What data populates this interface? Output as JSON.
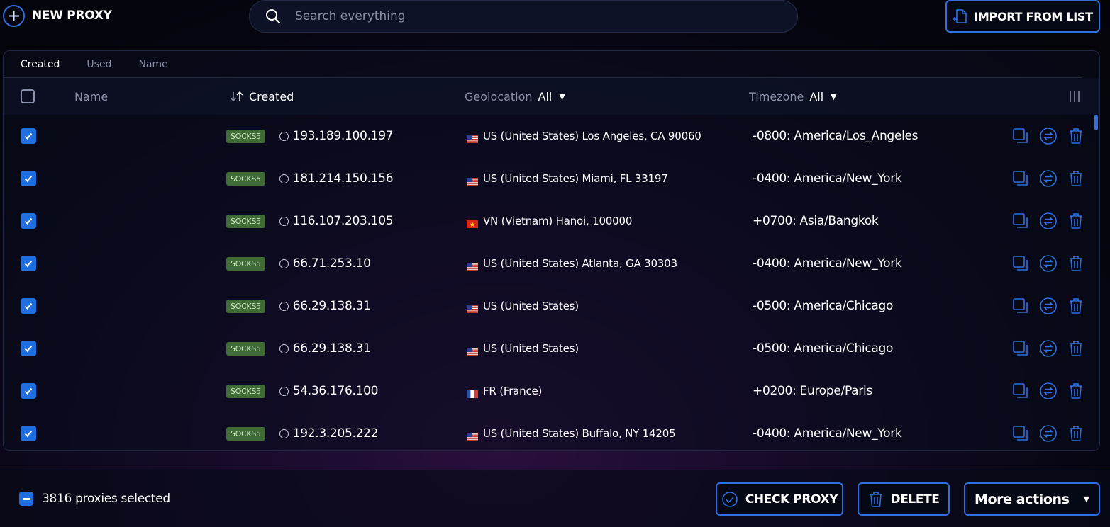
{
  "header": {
    "new_proxy_label": "NEW PROXY",
    "search_placeholder": "Search everything",
    "import_label": "IMPORT FROM LIST"
  },
  "sort_tabs": [
    {
      "label": "Created",
      "active": true
    },
    {
      "label": "Used",
      "active": false
    },
    {
      "label": "Name",
      "active": false
    }
  ],
  "columns": {
    "name": "Name",
    "created": "Created",
    "geolocation": "Geolocation",
    "geolocation_filter": "All",
    "timezone": "Timezone",
    "timezone_filter": "All"
  },
  "rows": [
    {
      "checked": true,
      "type": "SOCKS5",
      "ip": "193.189.100.197",
      "flag": "us",
      "geo": "US (United States) Los Angeles, CA 90060",
      "tz": "-0800: America/Los_Angeles"
    },
    {
      "checked": true,
      "type": "SOCKS5",
      "ip": "181.214.150.156",
      "flag": "us",
      "geo": "US (United States) Miami, FL 33197",
      "tz": "-0400: America/New_York"
    },
    {
      "checked": true,
      "type": "SOCKS5",
      "ip": "116.107.203.105",
      "flag": "vn",
      "geo": "VN (Vietnam) Hanoi, 100000",
      "tz": "+0700: Asia/Bangkok"
    },
    {
      "checked": true,
      "type": "SOCKS5",
      "ip": "66.71.253.10",
      "flag": "us",
      "geo": "US (United States) Atlanta, GA 30303",
      "tz": "-0400: America/New_York"
    },
    {
      "checked": true,
      "type": "SOCKS5",
      "ip": "66.29.138.31",
      "flag": "us",
      "geo": "US (United States)",
      "tz": "-0500: America/Chicago"
    },
    {
      "checked": true,
      "type": "SOCKS5",
      "ip": "66.29.138.31",
      "flag": "us",
      "geo": "US (United States)",
      "tz": "-0500: America/Chicago"
    },
    {
      "checked": true,
      "type": "SOCKS5",
      "ip": "54.36.176.100",
      "flag": "fr",
      "geo": "FR (France)",
      "tz": "+0200: Europe/Paris"
    },
    {
      "checked": true,
      "type": "SOCKS5",
      "ip": "192.3.205.222",
      "flag": "us",
      "geo": "US (United States) Buffalo, NY 14205",
      "tz": "-0400: America/New_York"
    }
  ],
  "footer": {
    "selected_text": "3816 proxies selected",
    "check_label": "CHECK PROXY",
    "delete_label": "DELETE",
    "more_label": "More actions"
  },
  "colors": {
    "accent": "#2f6fe0",
    "socks_badge": "#3f6b35"
  }
}
